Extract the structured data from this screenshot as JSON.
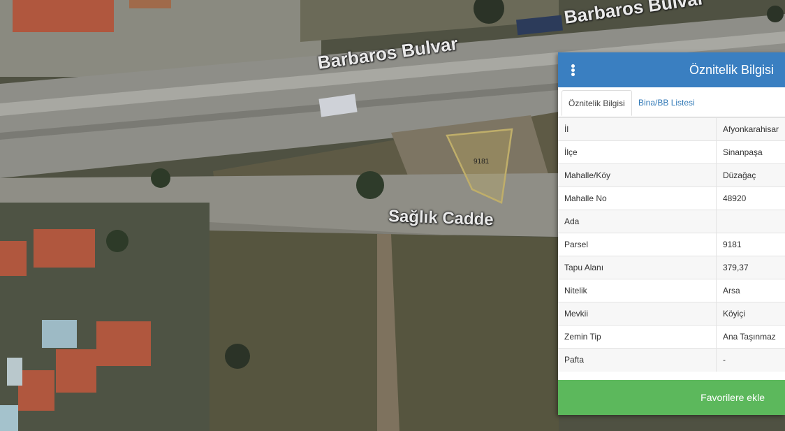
{
  "map": {
    "road_labels": [
      "Barbaros Bulvar",
      "Barbaros Bulvar",
      "Sağlık Cadde"
    ],
    "parcel_label": "9181"
  },
  "panel": {
    "title": "Öznitelik Bilgisi",
    "menu_icon": "vertical-ellipsis-icon",
    "tabs": [
      {
        "label": "Öznitelik Bilgisi",
        "active": true
      },
      {
        "label": "Bina/BB Listesi",
        "active": false
      }
    ],
    "rows": [
      {
        "key": "İl",
        "value": "Afyonkarahisar"
      },
      {
        "key": "İlçe",
        "value": "Sinanpaşa"
      },
      {
        "key": "Mahalle/Köy",
        "value": "Düzağaç"
      },
      {
        "key": "Mahalle No",
        "value": "48920"
      },
      {
        "key": "Ada",
        "value": ""
      },
      {
        "key": "Parsel",
        "value": "9181"
      },
      {
        "key": "Tapu Alanı",
        "value": "379,37"
      },
      {
        "key": "Nitelik",
        "value": "Arsa"
      },
      {
        "key": "Mevkii",
        "value": "Köyiçi"
      },
      {
        "key": "Zemin Tip",
        "value": "Ana Taşınmaz"
      },
      {
        "key": "Pafta",
        "value": "-"
      }
    ],
    "favorite_label": "Favorilere ekle"
  },
  "colors": {
    "header": "#3a7fc1",
    "favorite_button": "#5cb85c",
    "tab_link": "#337ab7",
    "parcel_outline": "#bfae6a"
  }
}
